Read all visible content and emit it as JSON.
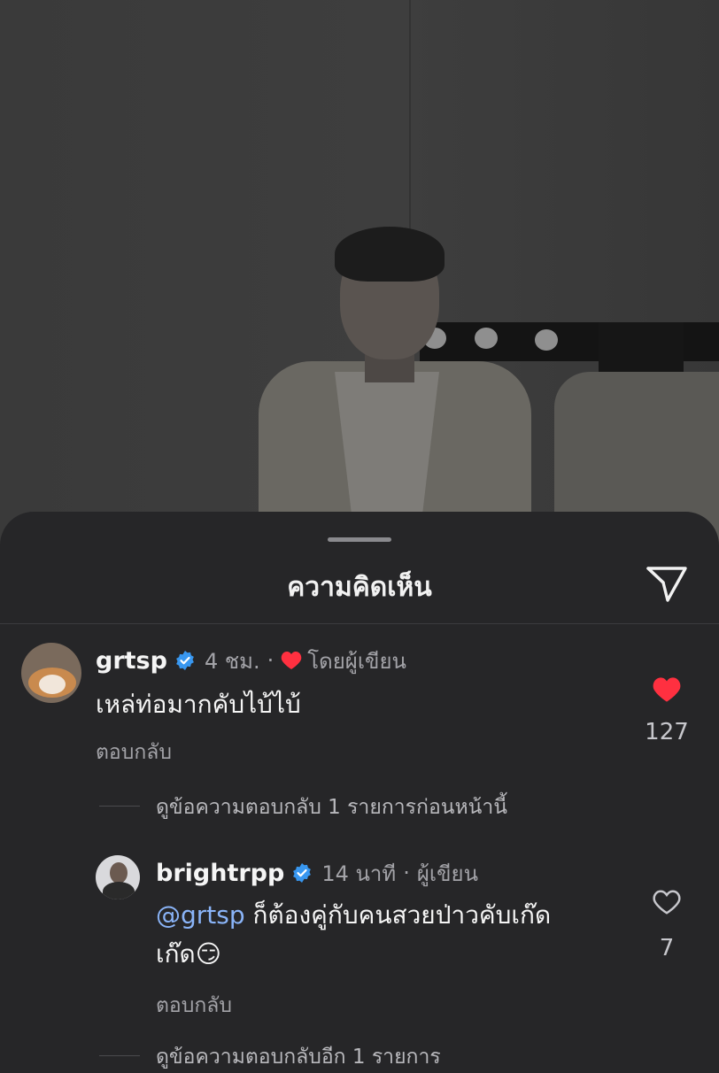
{
  "sheet": {
    "title": "ความคิดเห็น"
  },
  "comments": [
    {
      "username": "grtsp",
      "time": "4 ชม.",
      "separator": "·",
      "liked_by_author_label": "โดยผู้เขียน",
      "text": "เหล่ท่อมากคับไบ้ไบ้",
      "reply_label": "ตอบกลับ",
      "like_count": "127",
      "liked": true
    }
  ],
  "thread_toggle_previous": "ดูข้อความตอบกลับ 1 รายการก่อนหน้านี้",
  "replies": [
    {
      "username": "brightrpp",
      "time": "14 นาที",
      "separator": "·",
      "author_label": "ผู้เขียน",
      "mention": "@grtsp",
      "text_line1": " ก็ต้องคู่กับคนสวยป่าวคับเก๊ด",
      "text_line2": "เก๊ด",
      "emoji": "😏",
      "reply_label": "ตอบกลับ",
      "like_count": "7",
      "liked": false
    }
  ],
  "thread_toggle_more": "ดูข้อความตอบกลับอีก 1 รายการ",
  "colors": {
    "sheet_bg": "#262628",
    "like_red": "#ff3040",
    "verified_blue": "#3897f0",
    "mention_blue": "#8ab4f8"
  },
  "icons": [
    "share-icon",
    "verified-badge-icon",
    "heart-filled-icon",
    "heart-outline-icon"
  ]
}
